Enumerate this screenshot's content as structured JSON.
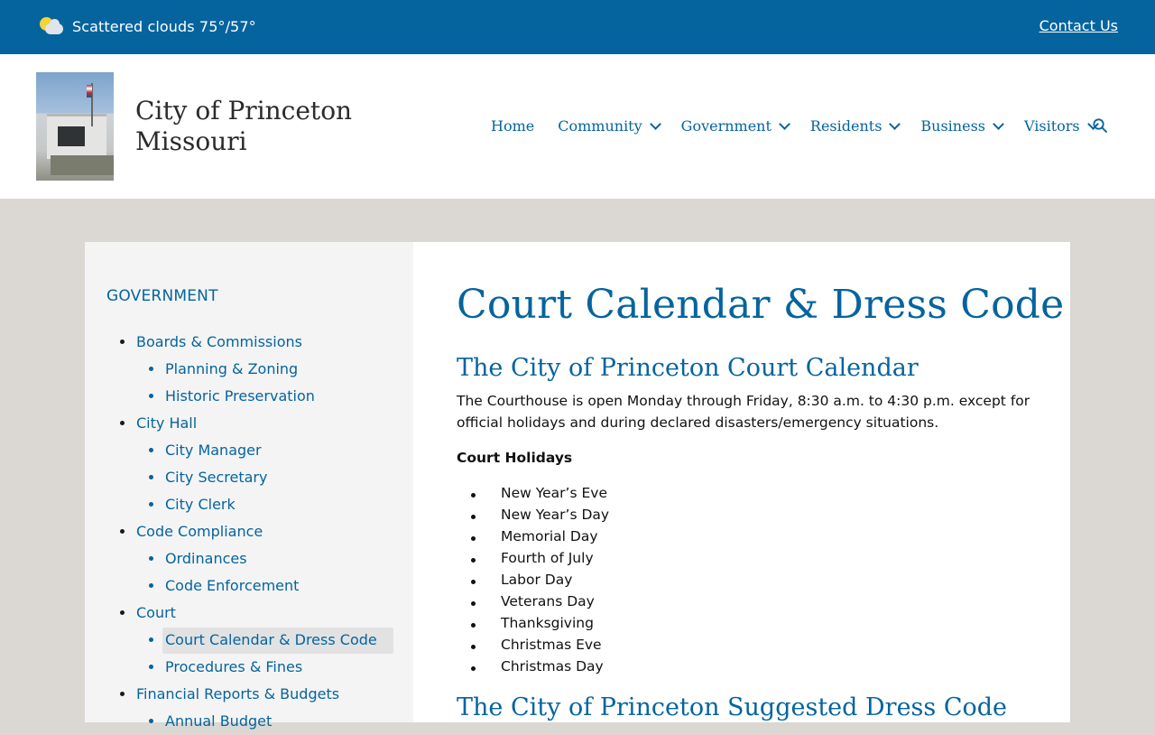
{
  "topbar": {
    "weather_icon": "partly-cloudy-icon",
    "weather_text": "Scattered clouds 75°/57°",
    "contact_label": "Contact Us"
  },
  "header": {
    "site_name_line1": "City of Princeton",
    "site_name_line2": "Missouri",
    "nav": [
      {
        "label": "Home"
      },
      {
        "label": "Community"
      },
      {
        "label": "Government"
      },
      {
        "label": "Residents"
      },
      {
        "label": "Business"
      },
      {
        "label": "Visitors"
      }
    ],
    "search_icon": "search-icon"
  },
  "sidebar": {
    "heading": "GOVERNMENT",
    "items": [
      {
        "label": "Boards & Commissions",
        "level": 1
      },
      {
        "label": "Planning & Zoning",
        "level": 2
      },
      {
        "label": "Historic Preservation",
        "level": 2
      },
      {
        "label": "City Hall",
        "level": 1
      },
      {
        "label": "City Manager",
        "level": 2
      },
      {
        "label": "City Secretary",
        "level": 2
      },
      {
        "label": "City Clerk",
        "level": 2
      },
      {
        "label": "Code Compliance",
        "level": 1
      },
      {
        "label": "Ordinances",
        "level": 2
      },
      {
        "label": "Code Enforcement",
        "level": 2
      },
      {
        "label": "Court",
        "level": 1
      },
      {
        "label": "Court Calendar & Dress Code",
        "level": 2,
        "active": true
      },
      {
        "label": "Procedures & Fines",
        "level": 2
      },
      {
        "label": "Financial Reports & Budgets",
        "level": 1
      },
      {
        "label": "Annual Budget",
        "level": 2
      }
    ]
  },
  "main": {
    "title": "Court Calendar & Dress Code",
    "section1_heading": "The City of Princeton Court Calendar",
    "section1_text": "The Courthouse is open Monday through Friday, 8:30 a.m. to 4:30 p.m. except for official holidays and during declared disasters/emergency situations.",
    "holidays_heading": "Court Holidays",
    "holidays": [
      "New Year’s Eve",
      "New Year’s Day",
      "Memorial Day",
      "Fourth of July",
      "Labor Day",
      "Veterans Day",
      "Thanksgiving",
      "Christmas Eve",
      "Christmas Day"
    ],
    "section2_heading": "The City of Princeton Suggested Dress Code"
  },
  "colors": {
    "brand_blue": "#05649e",
    "page_bg": "#dbd8d4",
    "sidebar_bg": "#f4f4f4"
  }
}
